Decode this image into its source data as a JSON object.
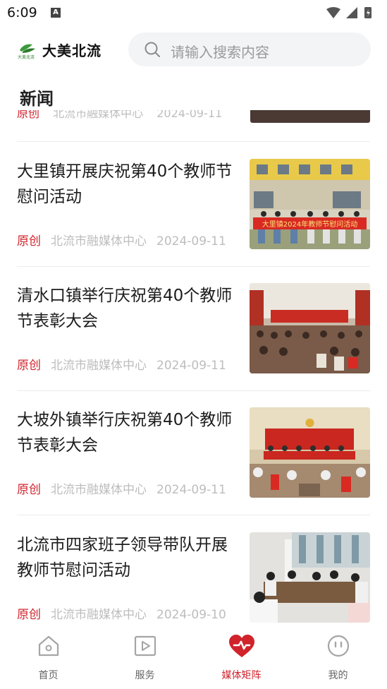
{
  "status_bar": {
    "time": "6:09",
    "notification": "A"
  },
  "header": {
    "app_name": "大美北流",
    "logo_small_text": "大美北流",
    "search_placeholder": "请输入搜索内容"
  },
  "section": {
    "title": "新闻"
  },
  "partial_item": {
    "tag": "原创",
    "source": "北流市融媒体中心",
    "date": "2024-09-11"
  },
  "articles": [
    {
      "title": "大里镇开展庆祝第40个教师节慰问活动",
      "tag": "原创",
      "source": "北流市融媒体中心",
      "date": "2024-09-11",
      "banner": "大里镇2024年教师节慰问活动"
    },
    {
      "title": "清水口镇举行庆祝第40个教师节表彰大会",
      "tag": "原创",
      "source": "北流市融媒体中心",
      "date": "2024-09-11"
    },
    {
      "title": "大坡外镇举行庆祝第40个教师节表彰大会",
      "tag": "原创",
      "source": "北流市融媒体中心",
      "date": "2024-09-11"
    },
    {
      "title": "北流市四家班子领导带队开展教师节慰问活动",
      "tag": "原创",
      "source": "北流市融媒体中心",
      "date": "2024-09-10"
    }
  ],
  "tabs": [
    {
      "label": "首页",
      "icon": "home-icon",
      "active": false
    },
    {
      "label": "服务",
      "icon": "play-icon",
      "active": false
    },
    {
      "label": "媒体矩阵",
      "icon": "heart-icon",
      "active": true
    },
    {
      "label": "我的",
      "icon": "face-icon",
      "active": false
    }
  ],
  "colors": {
    "accent": "#d0232c",
    "meta_gray": "#bdbdbd",
    "search_bg": "#f3f4f6"
  }
}
